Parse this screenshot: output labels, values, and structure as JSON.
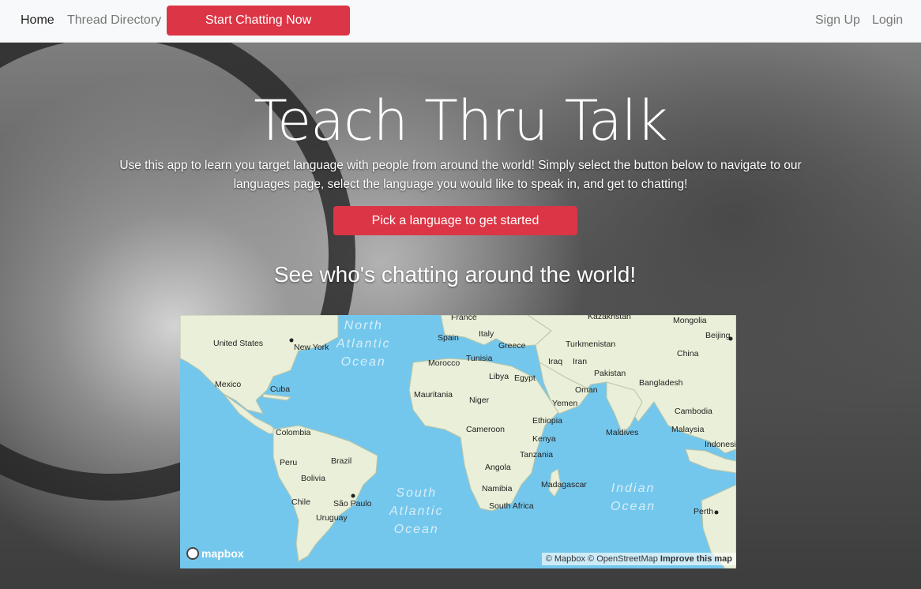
{
  "nav": {
    "home": "Home",
    "threads": "Thread Directory",
    "start": "Start Chatting Now",
    "signup": "Sign Up",
    "login": "Login"
  },
  "hero": {
    "title": "Teach Thru Talk",
    "lead": "Use this app to learn you target language with people from around the world! Simply select the button below to navigate to our languages page, select the language you would like to speak in, and get to chatting!",
    "cta": "Pick a language to get started",
    "subtitle": "See who's chatting around the world!"
  },
  "map": {
    "labels": [
      "United States",
      "New York",
      "Mexico",
      "Cuba",
      "Colombia",
      "Peru",
      "Brazil",
      "Bolivia",
      "Chile",
      "São Paulo",
      "Uruguay",
      "France",
      "Spain",
      "Italy",
      "Greece",
      "Morocco",
      "Tunisia",
      "Libya",
      "Egypt",
      "Mauritania",
      "Niger",
      "Cameroon",
      "Ethiopia",
      "Kenya",
      "Tanzania",
      "Angola",
      "Namibia",
      "South Africa",
      "Madagascar",
      "Kazakhstan",
      "Mongolia",
      "Beijing",
      "China",
      "Turkmenistan",
      "Iraq",
      "Iran",
      "Pakistan",
      "Bangladesh",
      "Oman",
      "Yemen",
      "Cambodia",
      "Malaysia",
      "Maldives",
      "Indonesi",
      "Perth"
    ],
    "oceans": [
      "North Atlantic Ocean",
      "South Atlantic Ocean",
      "Indian Ocean"
    ],
    "logo": "mapbox",
    "attribution": "© Mapbox © OpenStreetMap",
    "improve": "Improve this map"
  },
  "colors": {
    "accent": "#dc3545",
    "ocean": "#74c7ec",
    "land": "#e8efd6"
  }
}
